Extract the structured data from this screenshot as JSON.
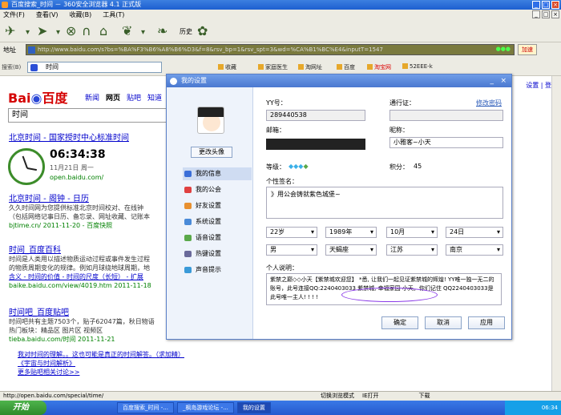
{
  "browser": {
    "title": "百度搜索_时间 － 360安全浏览器 4.1 正式版",
    "menu": [
      "文件(F)",
      "查看(V)",
      "收藏(B)",
      "工具(T)"
    ],
    "history_label": "历史",
    "address_label": "地址",
    "url": "http://www.baidu.com/s?bs=%BA%F3%B6%A8%B6%D3&f=8&rsv_bp=1&rsv_spt=3&wd=%CA%B1%BC%E4&inputT=1547",
    "add_button": "加速",
    "search_label": "搜索(B)",
    "search_value": "时间",
    "favorites": [
      "收藏",
      "家庭医生",
      "淘网址",
      "百度",
      "淘宝网",
      "52EEE-k"
    ],
    "status_url": "http://open.baidu.com/special/time/",
    "status_items": [
      "切换浏览模式",
      "IE打开",
      "下载"
    ]
  },
  "baidu": {
    "logo_text": "Bai",
    "logo_cn": "百度",
    "nav": [
      "新闻",
      "网页",
      "贴吧",
      "知道"
    ],
    "top_right": "设置 | 登录",
    "query": "时间",
    "results": [
      {
        "title": "北京时间 - 国家授时中心标准时间",
        "lines": [],
        "url": "open.baidu.com/ - "
      },
      {
        "title": "北京时间 - 阁钟 - 日历",
        "lines": [
          "久久时间网为您提供标准北京时间校对、在线钟",
          "（包括网络记事日历、备忘录、网址收藏、记账本"
        ],
        "url": "bjtime.cn/ 2011-11-20 - 百度快照"
      },
      {
        "title": "时间_百度百科",
        "lines": [
          "时间是人类用以描述物质运动过程或事件发生过程",
          "的物质周期变化的规律。例如月球绕地球周期，地",
          "含义 - 时间的价值 - 时间的尺度（长短） - 扩展"
        ],
        "url": "baike.baidu.com/view/4019.htm 2011-11-18"
      },
      {
        "title": "时间吧_百度贴吧",
        "lines": [
          "时间吧共有主题7503个，贴子62047篇，秋日物语",
          "热门板块：精品区  图片区  视频区"
        ],
        "url": "tieba.baidu.com/时间 2011-11-21"
      },
      {
        "title": "",
        "lines": [
          "我对时间的理解。。这也可能是真正的时间解答。（求加精）",
          "《宇宙与时间解析》",
          "更多贴吧相关讨论>>"
        ],
        "url": ""
      }
    ],
    "clock_time": "06:34:38",
    "clock_date": "11月21日  周一",
    "clock_src": "open.baidu.com/"
  },
  "dialog": {
    "title": "我的设置",
    "change_avatar": "更改头像",
    "sidebar": [
      {
        "label": "我的信息",
        "icon": "user-info-icon",
        "color": "#3a6ed8"
      },
      {
        "label": "我的公会",
        "icon": "guild-flag-icon",
        "color": "#e04040"
      },
      {
        "label": "好友设置",
        "icon": "friends-icon",
        "color": "#e89030"
      },
      {
        "label": "系统设置",
        "icon": "gear-icon",
        "color": "#4a8ad8"
      },
      {
        "label": "语音设置",
        "icon": "microphone-icon",
        "color": "#5aa84a"
      },
      {
        "label": "热键设置",
        "icon": "keyboard-icon",
        "color": "#6a6a9a"
      },
      {
        "label": "声音提示",
        "icon": "speaker-icon",
        "color": "#3a9ad8"
      }
    ],
    "yy_label": "YY号：",
    "yy_value": "289440538",
    "pass_label": "通行证：",
    "change_pwd": "修改密码",
    "email_label": "邮箱：",
    "nick_label": "昵称：",
    "nick_value": "小雅客~小天",
    "level_label": "等级：",
    "points_label": "积分：",
    "points_value": "45",
    "sig_label": "个性签名：",
    "sig_value": "》用公会铸就紫色城堡~",
    "age": "22岁",
    "year": "1989年",
    "month": "10月",
    "day": "24日",
    "gender": "男",
    "zodiac": "天蝎座",
    "province": "江苏",
    "city": "南京",
    "desc_label": "个人说明：",
    "desc_value": "紫禁之巅◇◇小天【紫禁城欢迎您】 *悉, 让我们一起见证紫禁城的辉煌! YY唯一独一无二的账号，此号连接QQ:2240403033  紫禁城, 幸福家园   小天。你们记住 QQ2240403033是此号唯一主人! ! ! !",
    "ok": "确定",
    "cancel": "取消",
    "apply": "应用"
  },
  "taskbar": {
    "start": "开始",
    "tasks": [
      "百度搜索_时间 -...",
      "_枫岛游戏论坛 -...",
      "我的设置"
    ],
    "tray_time": "06:34"
  }
}
